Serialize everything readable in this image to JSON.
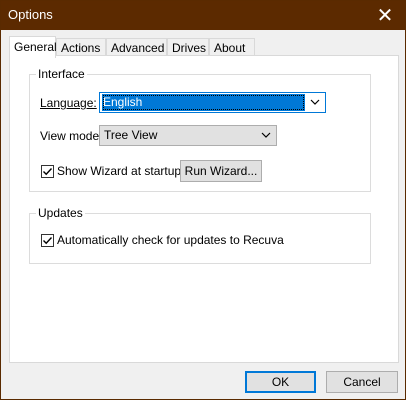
{
  "window": {
    "title": "Options"
  },
  "tabs": [
    {
      "label": "General",
      "active": true
    },
    {
      "label": "Actions"
    },
    {
      "label": "Advanced"
    },
    {
      "label": "Drives"
    },
    {
      "label": "About"
    }
  ],
  "interface": {
    "group_label": "Interface",
    "language_label": "Language:",
    "language_value": "English",
    "view_mode_label": "View mode",
    "view_mode_value": "Tree View",
    "show_wizard_label": "Show Wizard at startup",
    "show_wizard_checked": true,
    "run_wizard_label": "Run Wizard..."
  },
  "updates": {
    "group_label": "Updates",
    "auto_check_label": "Automatically check for updates to Recuva",
    "auto_check_checked": true
  },
  "footer": {
    "ok_label": "OK",
    "cancel_label": "Cancel"
  },
  "icons": {
    "close": "close-icon",
    "dropdown": "chevron-down-icon",
    "check": "checkmark-icon"
  },
  "colors": {
    "titlebar": "#5c2a00",
    "accent": "#0078d7"
  }
}
